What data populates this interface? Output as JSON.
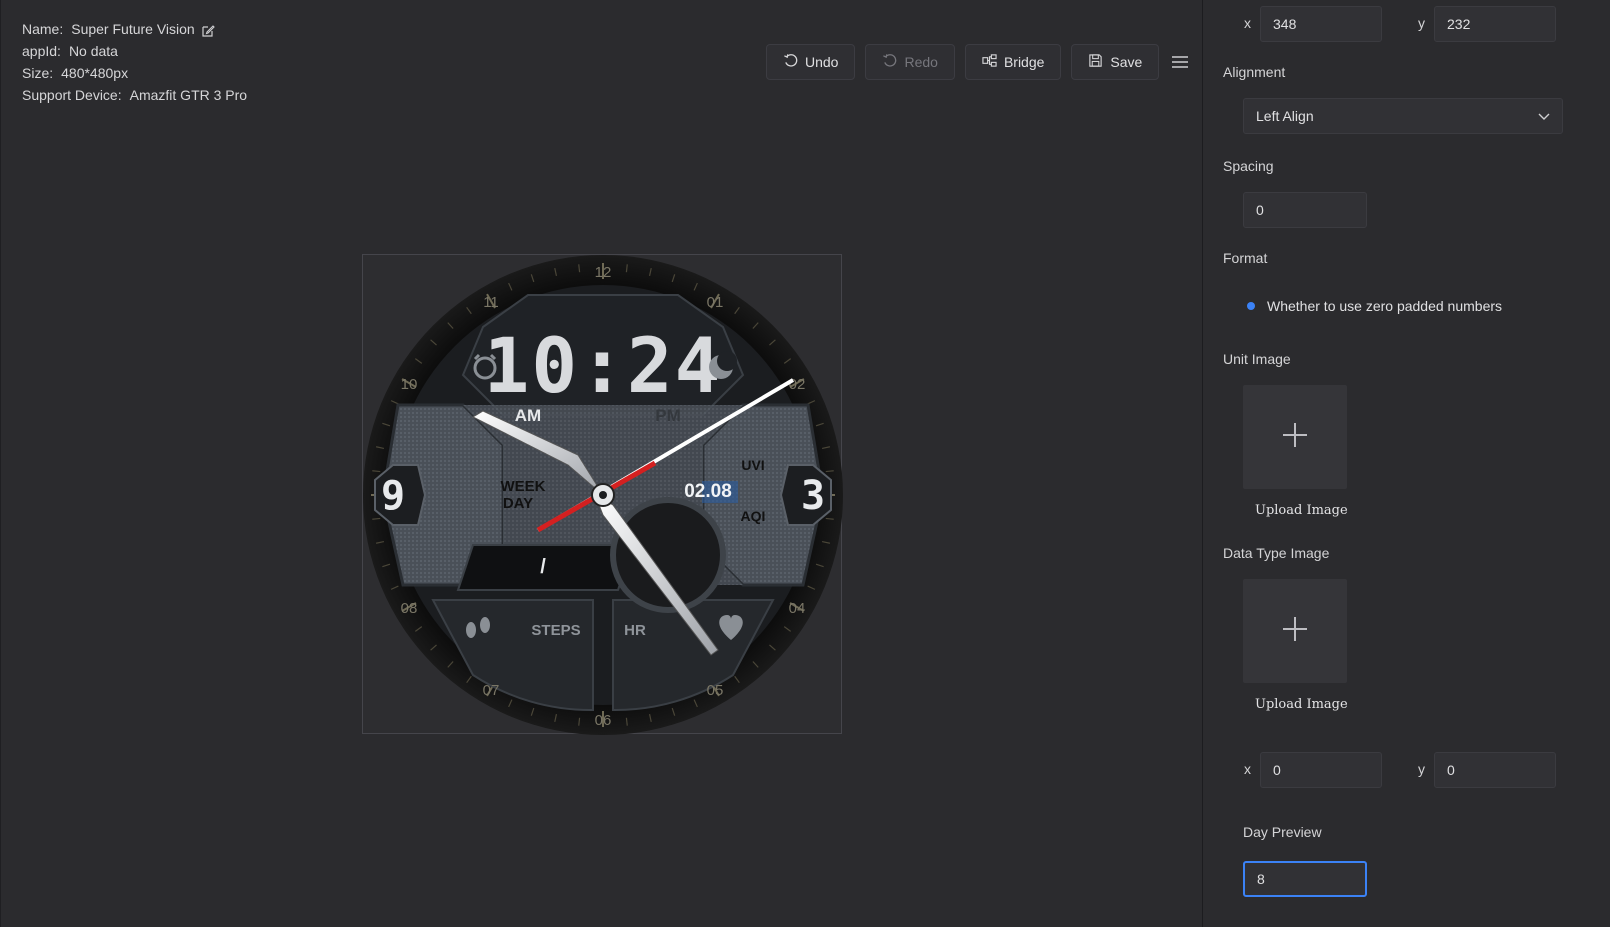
{
  "project": {
    "name_label": "Name:",
    "name_value": "Super Future Vision",
    "appid_label": "appId:",
    "appid_value": "No data",
    "size_label": "Size:",
    "size_value": "480*480px",
    "device_label": "Support Device:",
    "device_value": "Amazfit GTR 3 Pro"
  },
  "toolbar": {
    "undo": "Undo",
    "redo": "Redo",
    "bridge": "Bridge",
    "save": "Save"
  },
  "watchface": {
    "time": "10:24",
    "am": "AM",
    "pm": "PM",
    "weekday_line1": "WEEK",
    "weekday_line2": "DAY",
    "date": "02.08",
    "uvi": "UVI",
    "aqi": "AQI",
    "slash": "/",
    "steps": "STEPS",
    "hr": "HR",
    "left_numeral": "9",
    "right_numeral": "3",
    "bezel_numbers": [
      "12",
      "01",
      "02",
      "04",
      "05",
      "06",
      "07",
      "08",
      "10",
      "11"
    ]
  },
  "panel": {
    "x_label": "x",
    "x_value": "348",
    "y_label": "y",
    "y_value": "232",
    "alignment_label": "Alignment",
    "alignment_value": "Left Align",
    "spacing_label": "Spacing",
    "spacing_value": "0",
    "format_label": "Format",
    "format_option": "Whether to use zero padded numbers",
    "unit_image_label": "Unit Image",
    "unit_upload": "Upload Image",
    "data_type_image_label": "Data Type Image",
    "data_type_upload": "Upload Image",
    "x2_label": "x",
    "x2_value": "0",
    "y2_label": "y",
    "y2_value": "0",
    "day_preview_label": "Day Preview",
    "day_preview_value": "8"
  },
  "colors": {
    "accent": "#3b82f6",
    "background": "#2b2b2e",
    "second_hand": "#d42020"
  }
}
